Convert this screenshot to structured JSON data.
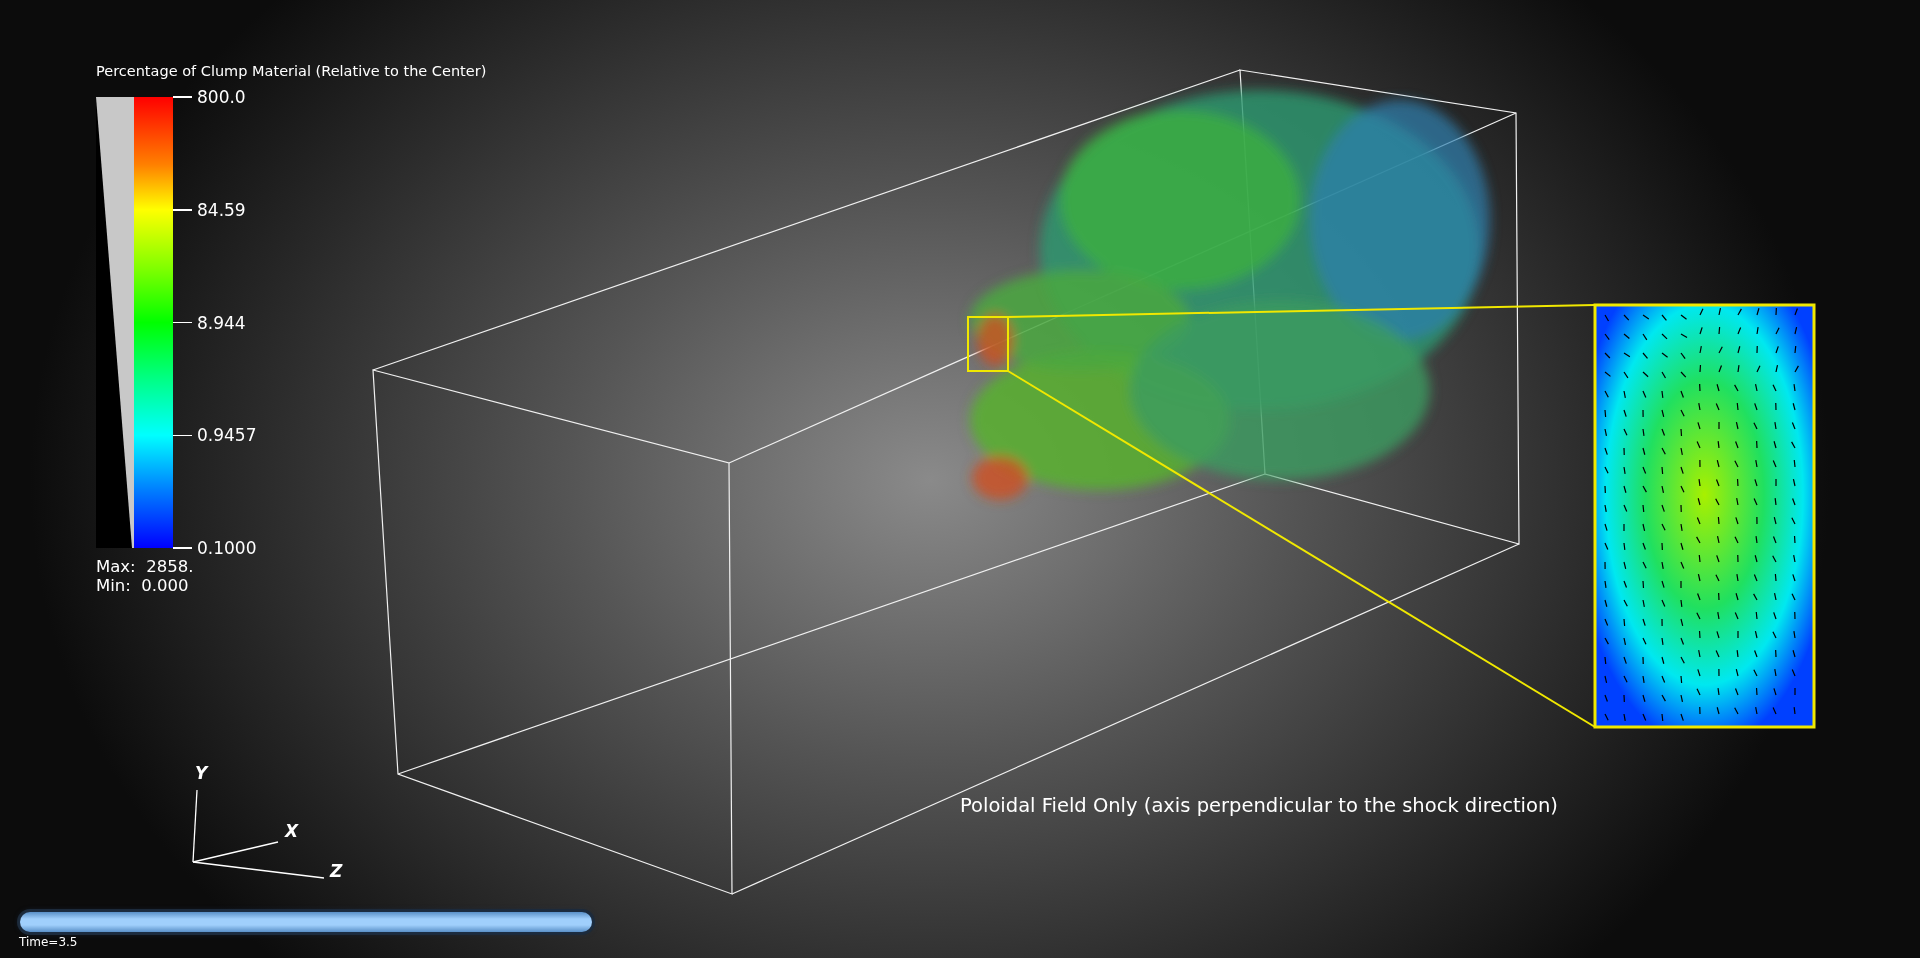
{
  "legend": {
    "title": "Percentage of Clump Material (Relative to the Center)",
    "ticks": [
      "800.0",
      "84.59",
      "8.944",
      "0.9457",
      "0.1000"
    ],
    "max_label": "Max:  2858.",
    "min_label": "Min:  0.000"
  },
  "axes": {
    "y": "Y",
    "x": "X",
    "z": "Z"
  },
  "caption": "Poloidal Field Only (axis perpendicular to the shock direction)",
  "time_slider": {
    "level": 1,
    "label": "Time=3.5"
  }
}
